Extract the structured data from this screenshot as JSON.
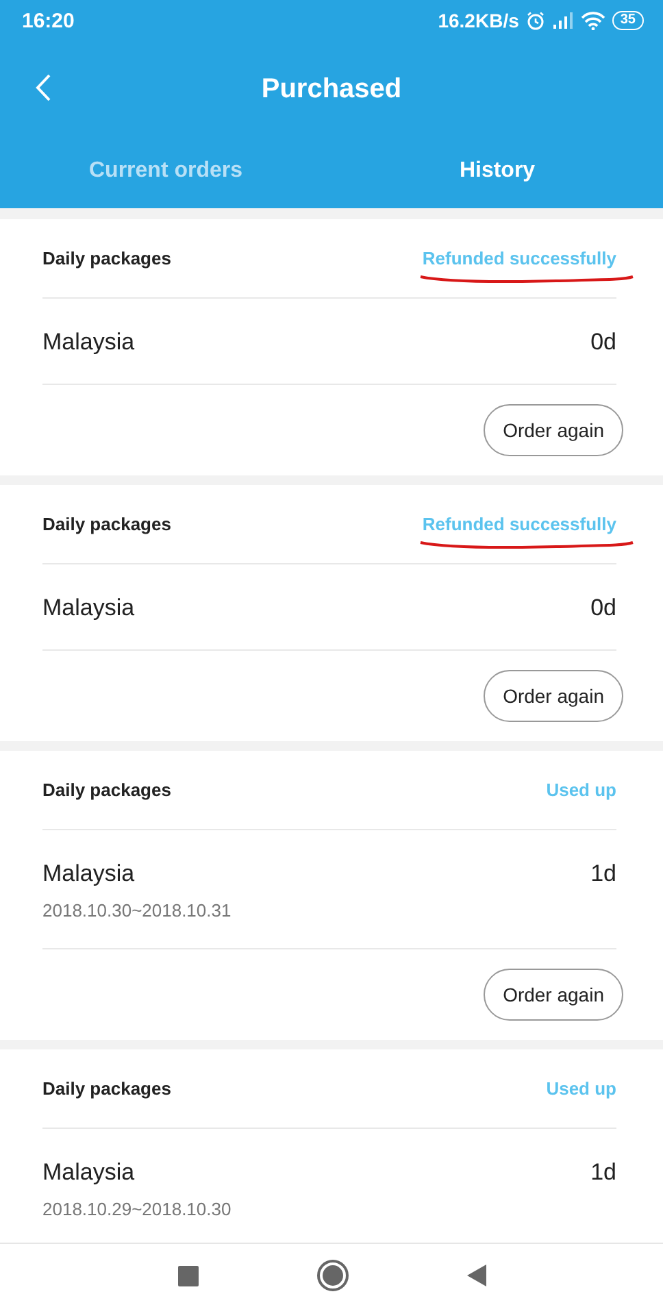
{
  "status_bar": {
    "time": "16:20",
    "speed": "16.2KB/s",
    "battery": "35"
  },
  "header": {
    "title": "Purchased"
  },
  "tabs": [
    {
      "label": "Current orders",
      "selected": false
    },
    {
      "label": "History",
      "selected": true
    }
  ],
  "orders": [
    {
      "package": "Daily packages",
      "status": "Refunded successfully",
      "underlined": true,
      "country": "Malaysia",
      "days": "0d",
      "button": "Order again"
    },
    {
      "package": "Daily packages",
      "status": "Refunded successfully",
      "underlined": true,
      "country": "Malaysia",
      "days": "0d",
      "button": "Order again"
    },
    {
      "package": "Daily packages",
      "status": "Used up",
      "underlined": false,
      "country": "Malaysia",
      "days": "1d",
      "dates": "2018.10.30~2018.10.31",
      "button": "Order again"
    },
    {
      "package": "Daily packages",
      "status": "Used up",
      "underlined": false,
      "country": "Malaysia",
      "days": "1d",
      "dates": "2018.10.29~2018.10.30"
    }
  ]
}
